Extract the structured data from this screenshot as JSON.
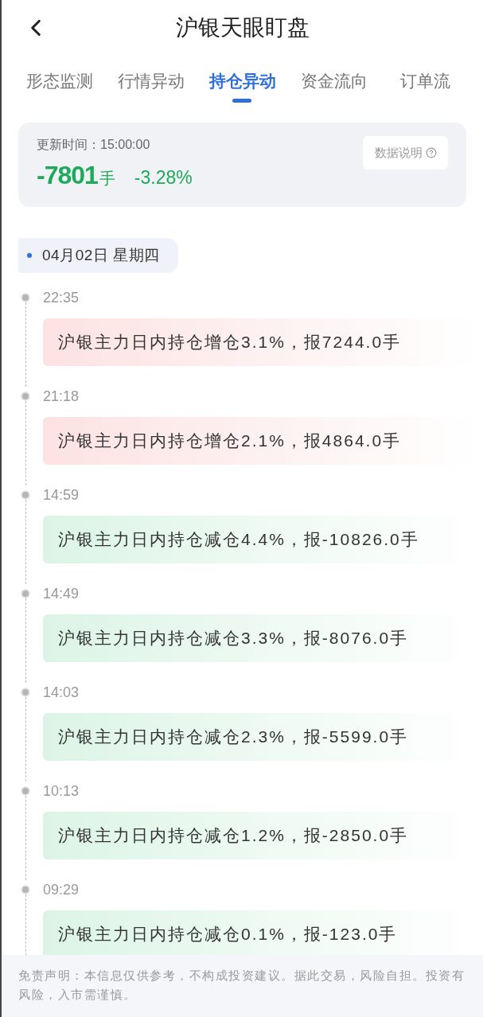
{
  "header": {
    "title": "沪银天眼盯盘"
  },
  "tabs": [
    {
      "label": "形态监测",
      "selected": false
    },
    {
      "label": "行情异动",
      "selected": false
    },
    {
      "label": "持仓异动",
      "selected": true
    },
    {
      "label": "资金流向",
      "selected": false
    },
    {
      "label": "订单流",
      "selected": false
    }
  ],
  "summary": {
    "update_time": "更新时间：15:00:00",
    "change_hands": "-7801",
    "unit": "手",
    "change_percent": "-3.28%",
    "info_button": "数据说明"
  },
  "date_label": "04月02日 星期四",
  "entries": [
    {
      "time": "22:35",
      "kind": "increase",
      "text": "沪银主力日内持仓增仓3.1%，报7244.0手"
    },
    {
      "time": "21:18",
      "kind": "increase",
      "text": "沪银主力日内持仓增仓2.1%，报4864.0手"
    },
    {
      "time": "14:59",
      "kind": "decrease",
      "text": "沪银主力日内持仓减仓4.4%，报-10826.0手"
    },
    {
      "time": "14:49",
      "kind": "decrease",
      "text": "沪银主力日内持仓减仓3.3%，报-8076.0手"
    },
    {
      "time": "14:03",
      "kind": "decrease",
      "text": "沪银主力日内持仓减仓2.3%，报-5599.0手"
    },
    {
      "time": "10:13",
      "kind": "decrease",
      "text": "沪银主力日内持仓减仓1.2%，报-2850.0手"
    },
    {
      "time": "09:29",
      "kind": "decrease",
      "text": "沪银主力日内持仓减仓0.1%，报-123.0手"
    }
  ],
  "disclaimer": "免责声明：本信息仅供参考，不构成投资建议。据此交易，风险自担。投资有风险，入市需谨慎。"
}
